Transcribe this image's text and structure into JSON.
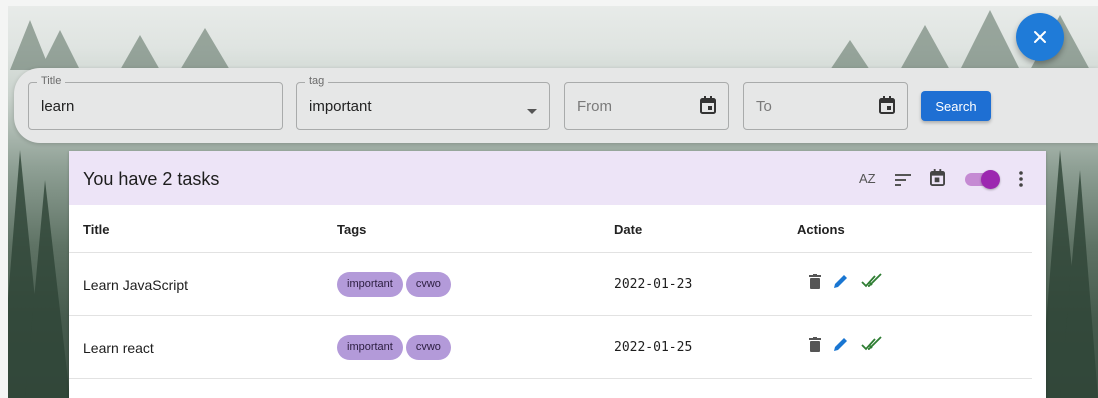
{
  "filters": {
    "title_label": "Title",
    "title_value": "learn",
    "tag_label": "tag",
    "tag_value": "important",
    "from_placeholder": "From",
    "to_placeholder": "To",
    "search_label": "Search"
  },
  "tasks_panel": {
    "heading": "You have 2 tasks",
    "sort_alpha_label": "AZ",
    "toggle_on": true,
    "columns": [
      "Title",
      "Tags",
      "Date",
      "Actions"
    ],
    "rows": [
      {
        "title": "Learn JavaScript",
        "tags": [
          "important",
          "cvwo"
        ],
        "date": "2022-01-23"
      },
      {
        "title": "Learn react",
        "tags": [
          "important",
          "cvwo"
        ],
        "date": "2022-01-25"
      }
    ]
  },
  "icons": {
    "close": "close-icon",
    "dropdown": "arrow-drop-down-icon",
    "calendar": "calendar-icon",
    "sort_alpha": "sort-by-alpha-icon",
    "sort": "sort-icon",
    "more": "more-vert-icon",
    "delete": "trash-icon",
    "edit": "pencil-icon",
    "done": "double-check-icon"
  },
  "colors": {
    "primary": "#1e6fd3",
    "fab": "#1f7bd8",
    "header_bg": "#ede4f7",
    "chip_bg": "#b39ad9",
    "toggle": "#9c27b0",
    "edit_icon": "#1976d2",
    "done_icon": "#2e7d32"
  }
}
